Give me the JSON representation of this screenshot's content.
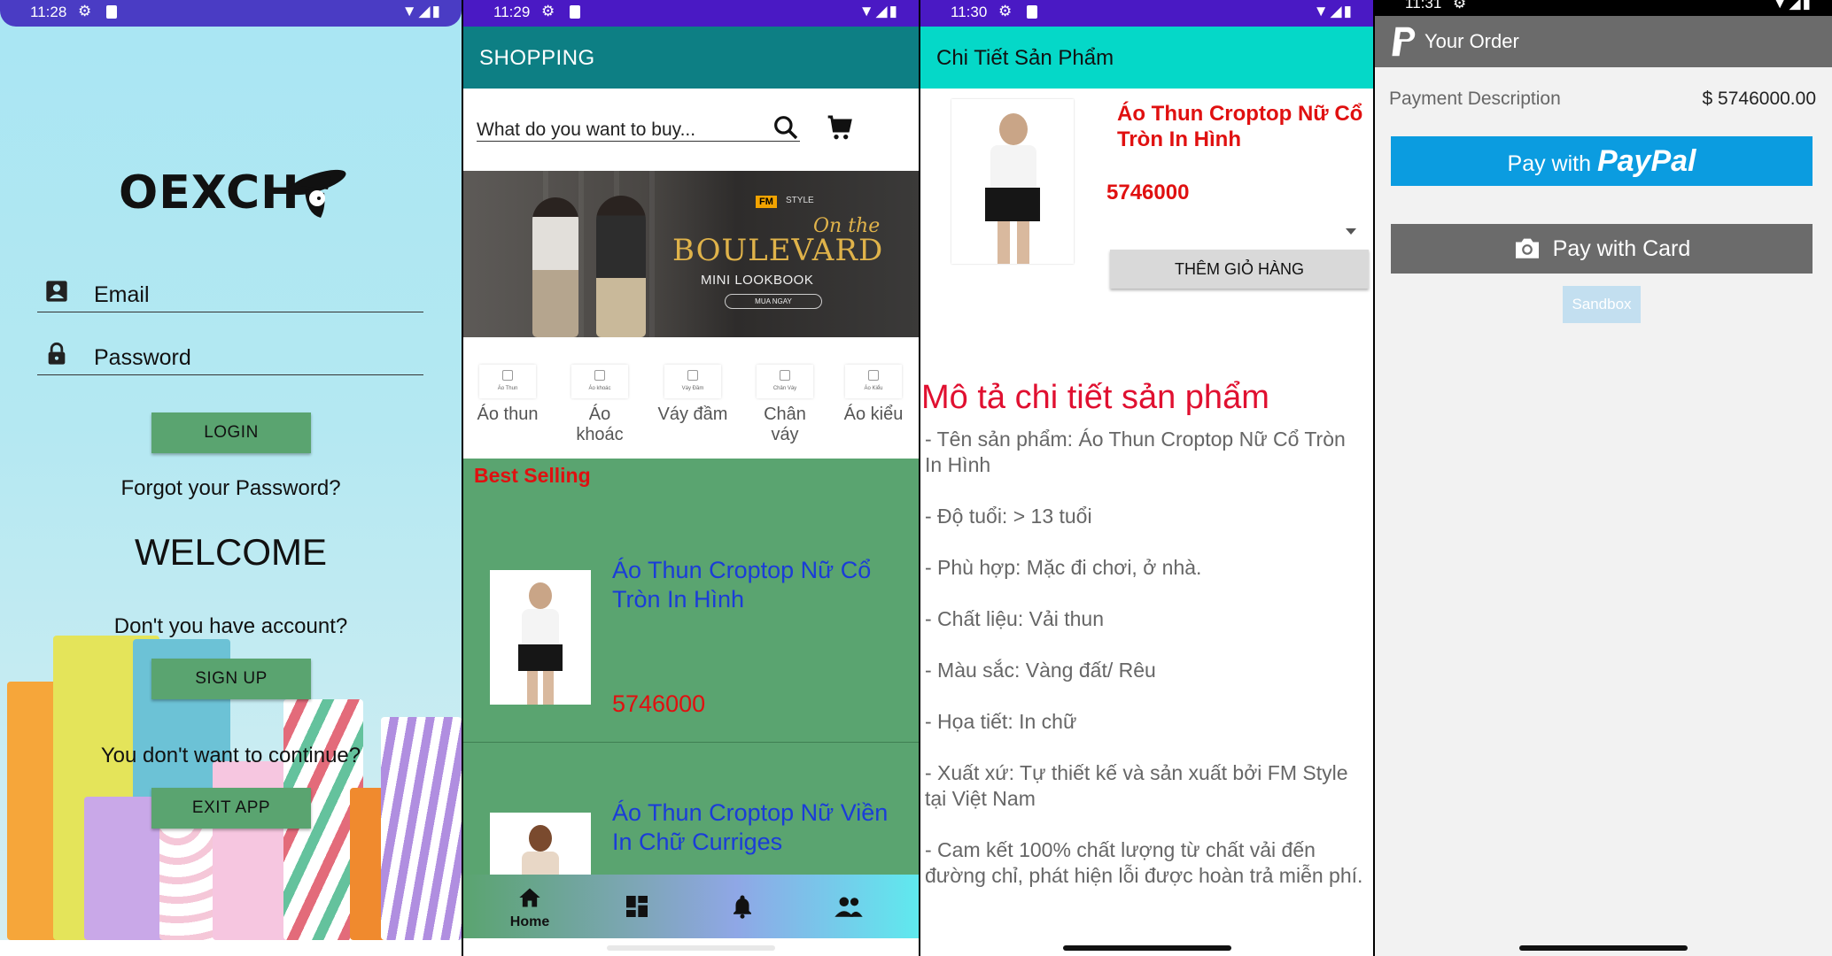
{
  "login_screen": {
    "status_time": "11:28",
    "logo_text": "OEXCH",
    "email_label": "Email",
    "password_label": "Password",
    "login_button": "LOGIN",
    "forgot_password": "Forgot your Password?",
    "welcome": "WELCOME",
    "no_account": "Don't you have account?",
    "signup_button": "SIGN UP",
    "dont_continue": "You don't want to continue?",
    "exit_button": "EXIT APP"
  },
  "shopping_screen": {
    "status_time": "11:29",
    "app_title": "SHOPPING",
    "search_placeholder": "What do you want to buy...",
    "banner": {
      "brand": "FM",
      "brand_sub": "STYLE",
      "on_the": "On the",
      "title": "BOULEVARD",
      "subtitle": "MINI LOOKBOOK",
      "cta": "MUA NGAY"
    },
    "categories": [
      {
        "label": "Áo thun",
        "thumb": "Áo Thun"
      },
      {
        "label": "Áo khoác",
        "thumb": "Áo khoác"
      },
      {
        "label": "Váy đầm",
        "thumb": "Váy Đầm"
      },
      {
        "label": "Chân váy",
        "thumb": "Chân Váy"
      },
      {
        "label": "Áo kiểu",
        "thumb": "Áo Kiểu"
      }
    ],
    "best_selling_title": "Best Selling",
    "products": [
      {
        "name": "Áo Thun Croptop Nữ Cổ Tròn In Hình",
        "price": "5746000"
      },
      {
        "name": "Áo Thun Croptop Nữ Viền In Chữ Curriges",
        "price": ""
      }
    ],
    "bottom_nav": {
      "home": "Home"
    }
  },
  "detail_screen": {
    "status_time": "11:30",
    "app_title": "Chi Tiết Sản Phẩm",
    "product_name": "Áo Thun Croptop Nữ Cổ Tròn In Hình",
    "price": "5746000",
    "add_to_cart": "THÊM GIỎ HÀNG",
    "description_heading": "Mô tả chi tiết sản phẩm",
    "description_lines": [
      "- Tên sản phẩm: Áo Thun Croptop Nữ Cổ Tròn In Hình",
      "- Độ tuổi: > 13 tuổi",
      "- Phù hợp: Mặc đi chơi, ở nhà.",
      "- Chất liệu: Vải thun",
      "- Màu sắc: Vàng đất/ Rêu",
      "- Họa tiết: In chữ",
      "- Xuất xứ: Tự thiết kế và sản xuất bởi FM Style tại Việt Nam",
      "- Cam kết 100% chất lượng từ chất vải đến đường chỉ, phát hiện lỗi được hoàn trả miễn phí."
    ]
  },
  "payment_screen": {
    "status_time": "11:31",
    "app_title": "Your Order",
    "payment_description": "Payment Description",
    "amount": "$ 5746000.00",
    "paypal_prefix": "Pay with",
    "paypal_brand": "PayPal",
    "card_button": "Pay with Card",
    "sandbox": "Sandbox"
  },
  "colors": {
    "login_button": "#5aa470",
    "shopping_appbar": "#0d7f84",
    "detail_appbar": "#05d8c8",
    "price_red": "#e01010",
    "product_link_blue": "#1a3cd8",
    "paypal_blue": "#0b9ce0",
    "payment_appbar": "#6b6b6b"
  },
  "icons": [
    "person-icon",
    "lock-icon",
    "search-icon",
    "cart-icon",
    "home-icon",
    "dashboard-icon",
    "bell-icon",
    "people-icon",
    "camera-icon",
    "paypal-logo-icon",
    "settings-icon",
    "sd-card-icon",
    "wifi-icon",
    "signal-icon",
    "battery-icon"
  ]
}
